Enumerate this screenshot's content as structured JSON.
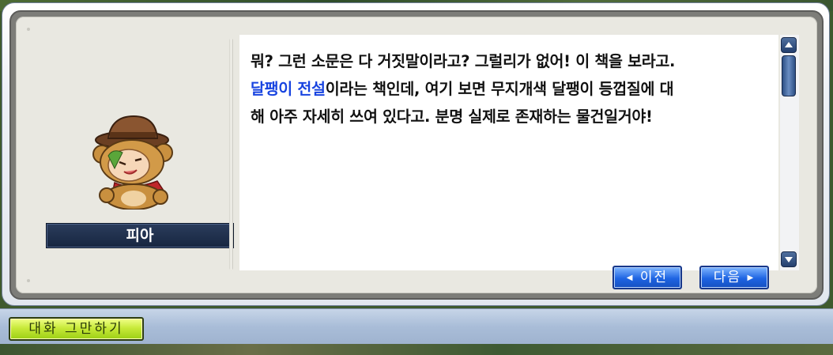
{
  "npc": {
    "name": "피아",
    "portrait_icon": "bear-costume-npc-icon"
  },
  "dialogue": {
    "line1": "뭐? 그런 소문은 다 거짓말이라고? 그럴리가 없어! 이 책을 보라고.",
    "highlight": "달팽이 전설",
    "line2_rest": "이라는 책인데, 여기 보면 무지개색 달팽이 등껍질에 대",
    "line3": "해 아주 자세히 쓰여 있다고. 분명 실제로 존재하는 물건일거야!"
  },
  "buttons": {
    "prev": "이전",
    "next": "다음",
    "end_chat": "대화 그만하기"
  },
  "colors": {
    "highlight_text": "#1844e0",
    "nav_button": "#1e64e2",
    "end_button": "#c8ea3a"
  }
}
